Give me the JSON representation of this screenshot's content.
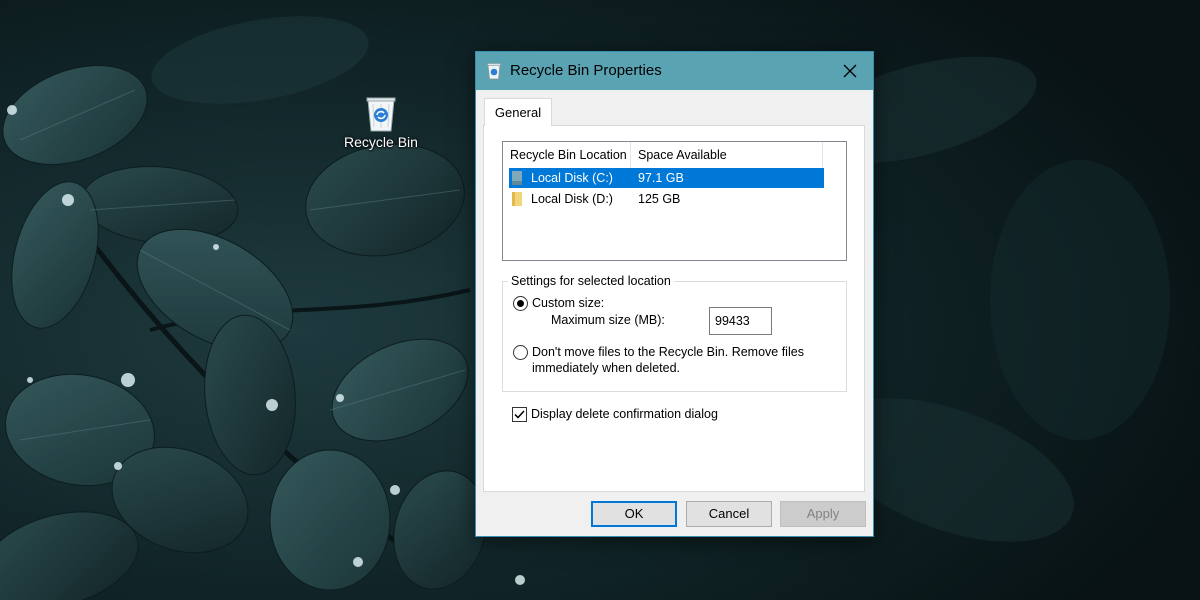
{
  "desktop": {
    "icon_label": "Recycle Bin",
    "icon": "recycle-bin-icon"
  },
  "window": {
    "title": "Recycle Bin Properties",
    "title_icon": "recycle-bin-icon",
    "close_icon": "close-icon",
    "titlebar_color": "#5aa3b3",
    "tabs": [
      {
        "label": "General",
        "selected": true
      }
    ],
    "list": {
      "columns": [
        "Recycle Bin Location",
        "Space Available"
      ],
      "rows": [
        {
          "location": "Local Disk (C:)",
          "space": "97.1 GB",
          "selected": true,
          "icon": "drive-icon"
        },
        {
          "location": "Local Disk (D:)",
          "space": "125 GB",
          "selected": false,
          "icon": "folder-drive-icon"
        }
      ],
      "selection_color": "#0078d7"
    },
    "settings": {
      "group_label": "Settings for selected location",
      "custom_size_label": "Custom size:",
      "custom_size_selected": true,
      "max_size_label": "Maximum size (MB):",
      "max_size_value": "99433",
      "no_move_label_line1": "Don't move files to the Recycle Bin. Remove files",
      "no_move_label_line2": "immediately when deleted.",
      "no_move_selected": false
    },
    "confirm_dialog": {
      "label": "Display delete confirmation dialog",
      "checked": true
    },
    "buttons": {
      "ok": "OK",
      "cancel": "Cancel",
      "apply": "Apply",
      "apply_enabled": false
    }
  }
}
